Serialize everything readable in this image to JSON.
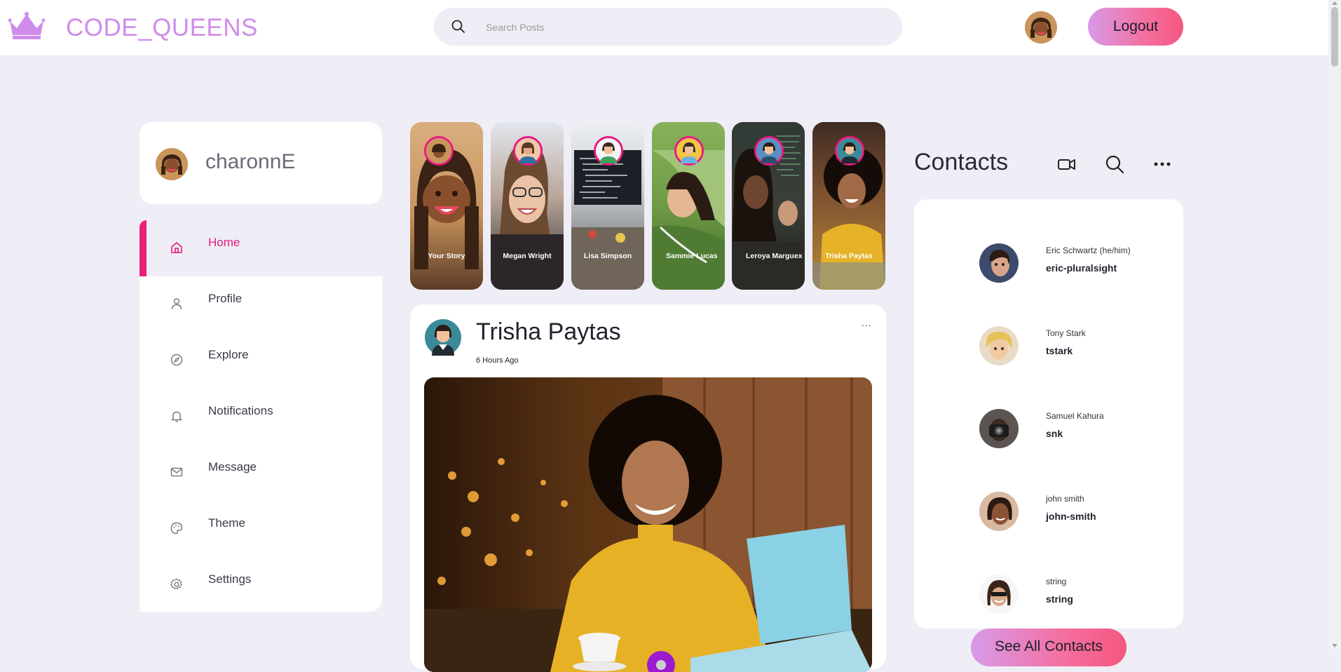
{
  "brand": {
    "name": "CODE_QUEENS",
    "logo_icon": "crown-icon",
    "color": "#cf8cea"
  },
  "search": {
    "placeholder": "Search Posts",
    "icon": "search-icon"
  },
  "header": {
    "logout_label": "Logout"
  },
  "accent": "#e81a7f",
  "user": {
    "username": "charonnE"
  },
  "sidebar": {
    "items": [
      {
        "label": "Home",
        "icon": "home-icon",
        "active": true
      },
      {
        "label": "Profile",
        "icon": "user-icon"
      },
      {
        "label": "Explore",
        "icon": "compass-icon"
      },
      {
        "label": "Notifications",
        "icon": "bell-icon"
      },
      {
        "label": "Message",
        "icon": "mail-icon"
      },
      {
        "label": "Theme",
        "icon": "palette-icon"
      },
      {
        "label": "Settings",
        "icon": "gear-icon"
      }
    ]
  },
  "stories": [
    {
      "name": "Your Story"
    },
    {
      "name": "Megan Wright"
    },
    {
      "name": "Lisa Simpson"
    },
    {
      "name": "Sammie Lucas"
    },
    {
      "name": "Leroya Marguex"
    },
    {
      "name": "Trisha Paytas"
    }
  ],
  "post": {
    "author": "Trisha Paytas",
    "time": "6 Hours Ago",
    "more": "..."
  },
  "contacts": {
    "title": "Contacts",
    "list": [
      {
        "name": "Eric Schwartz (he/him)",
        "username": "eric-pluralsight"
      },
      {
        "name": "Tony Stark",
        "username": "tstark"
      },
      {
        "name": "Samuel Kahura",
        "username": "snk"
      },
      {
        "name": "john smith",
        "username": "john-smith"
      },
      {
        "name": "string",
        "username": "string"
      }
    ],
    "see_all_label": "See All Contacts"
  }
}
